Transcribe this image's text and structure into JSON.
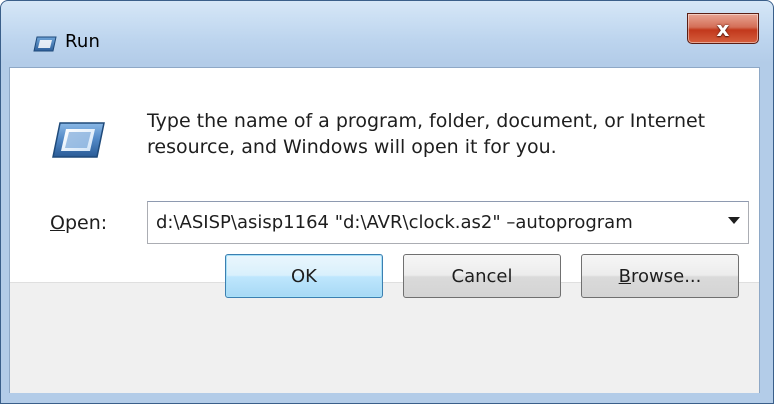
{
  "window": {
    "title": "Run"
  },
  "titlebar": {
    "close_label": "x"
  },
  "description": {
    "text": "Type the name of a program, folder, document, or Internet resource, and Windows will open it for you."
  },
  "open_field": {
    "label_accel": "O",
    "label_rest": "pen:",
    "value": "d:\\ASISP\\asisp1164 \"d:\\AVR\\clock.as2\" –autoprogram"
  },
  "buttons": {
    "ok": "OK",
    "cancel": "Cancel",
    "browse_accel": "B",
    "browse_rest": "rowse..."
  },
  "icons": {
    "title": "run-icon",
    "body": "run-icon",
    "close": "close-icon",
    "dropdown": "chevron-down-icon"
  },
  "colors": {
    "close_button": "#c2381c",
    "default_button_border": "#3c7fb1"
  }
}
